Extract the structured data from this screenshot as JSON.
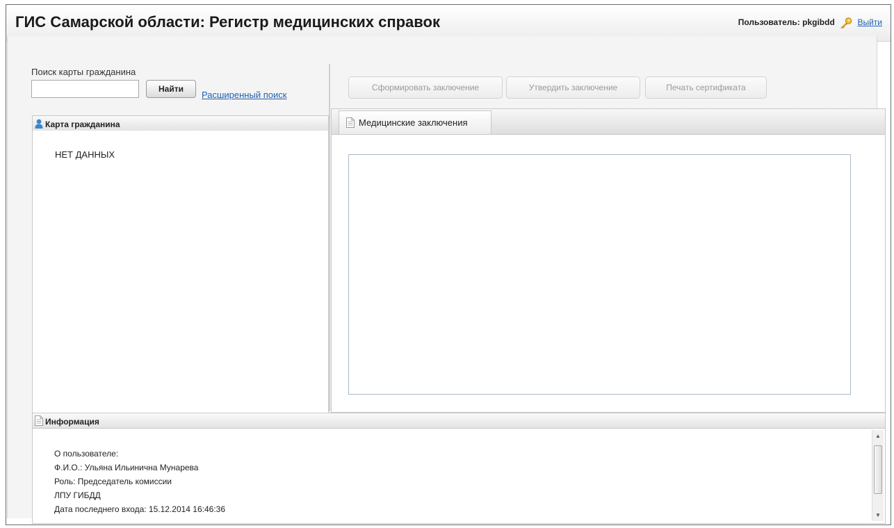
{
  "header": {
    "title": "ГИС Самарской области: Регистр медицинских справок",
    "user_label": "Пользователь: pkgibdd",
    "logout_label": "Выйти"
  },
  "search": {
    "label": "Поиск карты гражданина",
    "input_value": "",
    "find_label": "Найти",
    "advanced_label": "Расширенный поиск"
  },
  "toolbar": {
    "buttons": [
      {
        "label": "Сформировать заключение",
        "enabled": false
      },
      {
        "label": "Утвердить заключение",
        "enabled": false
      },
      {
        "label": "Печать сертификата",
        "enabled": false
      }
    ]
  },
  "citizen_card": {
    "title": "Карта гражданина",
    "empty_text": "НЕТ ДАННЫХ"
  },
  "tabs": [
    {
      "label": "Медицинские заключения",
      "active": true
    }
  ],
  "info": {
    "title": "Информация",
    "lines": [
      "О пользователе:",
      "Ф.И.О.: Ульяна Ильинична Мунарева",
      "Роль: Председатель комиссии",
      "ЛПУ ГИБДД",
      "Дата последнего входа: 15.12.2014 16:46:36"
    ]
  },
  "colors": {
    "link": "#1f5fb5",
    "disabled_text": "#9a9a9a",
    "user_icon": "#3a86c8",
    "key_icon": "#e6b422"
  },
  "icons": {
    "user": "user-icon",
    "key": "key-icon",
    "document": "document-icon"
  }
}
